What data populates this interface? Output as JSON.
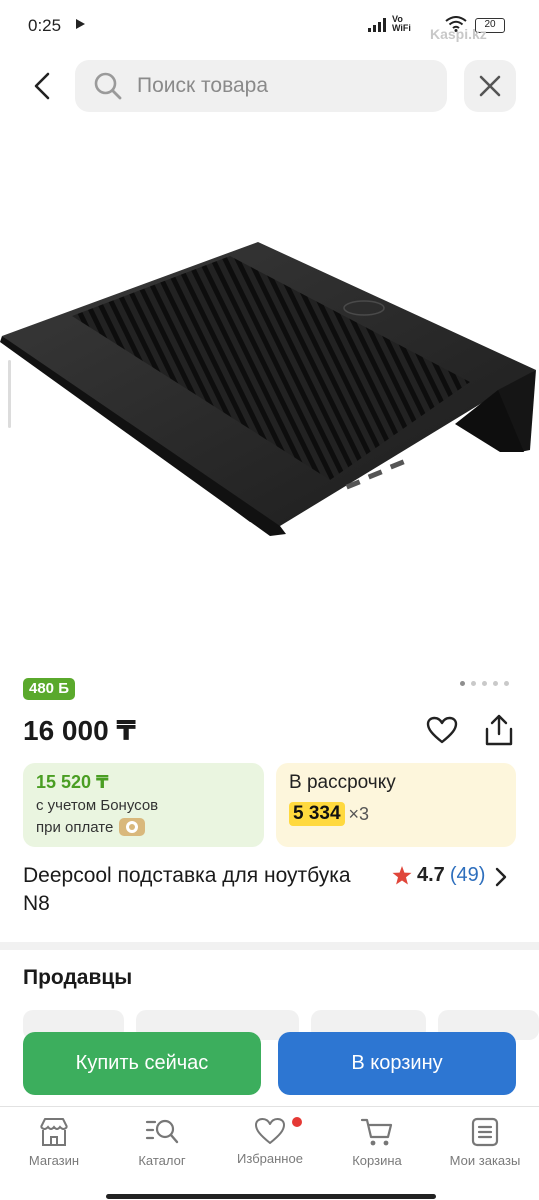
{
  "status_bar": {
    "time": "0:25",
    "vowifi_top": "Vo",
    "vowifi_bottom": "WiFi",
    "battery": "20",
    "watermark": "Kaspi.kz"
  },
  "search": {
    "placeholder": "Поиск товара"
  },
  "product": {
    "bonus_badge": "480 Б",
    "price": "16 000 ₸",
    "image_count": 5,
    "active_image": 1,
    "bonus_price": "15 520 ₸",
    "bonus_line1": "с учетом Бонусов",
    "bonus_line2": "при оплате",
    "installment_label": "В рассрочку",
    "installment_amount": "5 334",
    "installment_months": "×3",
    "title": "Deepcool подставка для ноутбука N8",
    "rating": "4.7",
    "reviews": "(49)"
  },
  "sellers": {
    "title": "Продавцы"
  },
  "actions": {
    "buy_now": "Купить сейчас",
    "to_cart": "В корзину"
  },
  "nav": {
    "items": [
      {
        "label": "Магазин",
        "icon": "shop-icon"
      },
      {
        "label": "Каталог",
        "icon": "catalog-icon"
      },
      {
        "label": "Избранное",
        "icon": "heart-icon"
      },
      {
        "label": "Корзина",
        "icon": "cart-icon"
      },
      {
        "label": "Мои заказы",
        "icon": "orders-icon"
      }
    ]
  },
  "colors": {
    "green_accent": "#3cae5d",
    "blue_accent": "#2d76d2",
    "bonus_green": "#5aa92c",
    "installment_yellow": "#ffd93e",
    "rating_star": "#e0463a"
  }
}
